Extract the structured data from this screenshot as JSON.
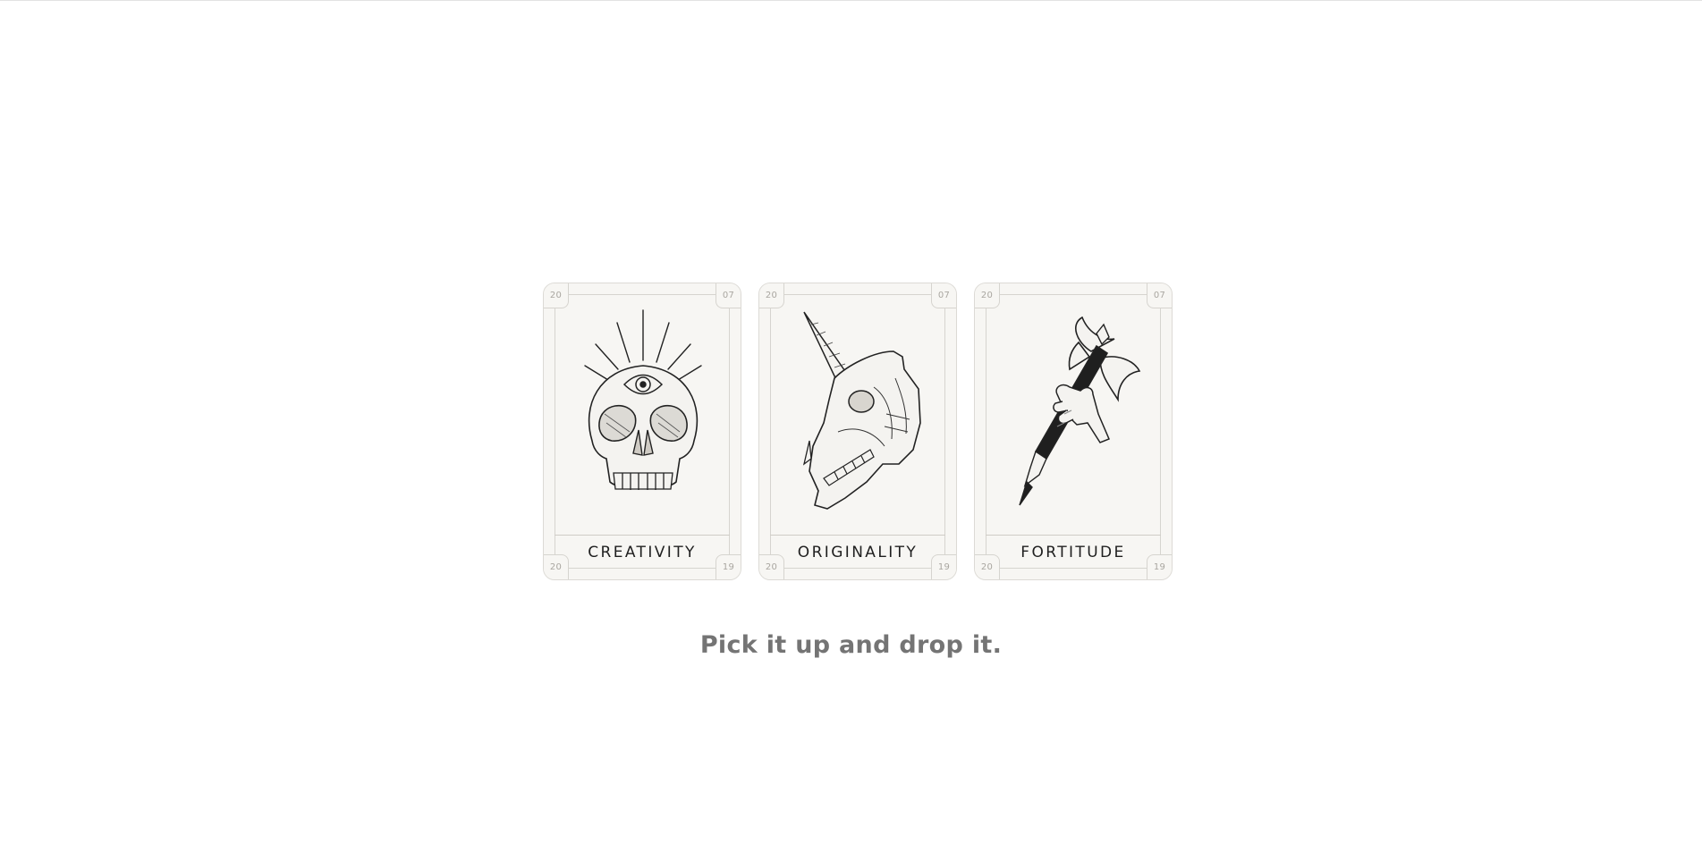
{
  "instruction": "Pick it up and drop it.",
  "cards": [
    {
      "title": "CREATIVITY",
      "illustration": "three-eyed-skull-icon",
      "corners": {
        "top_left": "20",
        "top_right": "07",
        "bottom_left": "20",
        "bottom_right": "19"
      }
    },
    {
      "title": "ORIGINALITY",
      "illustration": "unicorn-skull-icon",
      "corners": {
        "top_left": "20",
        "top_right": "07",
        "bottom_left": "20",
        "bottom_right": "19"
      }
    },
    {
      "title": "FORTITUDE",
      "illustration": "hand-holding-axe-pen-icon",
      "corners": {
        "top_left": "20",
        "top_right": "07",
        "bottom_left": "20",
        "bottom_right": "19"
      }
    }
  ],
  "colors": {
    "card_background": "#f7f6f3",
    "card_border": "#dcdad5",
    "title_text": "#1f1f1f",
    "instruction_text": "#747474",
    "ink": "#222222"
  }
}
